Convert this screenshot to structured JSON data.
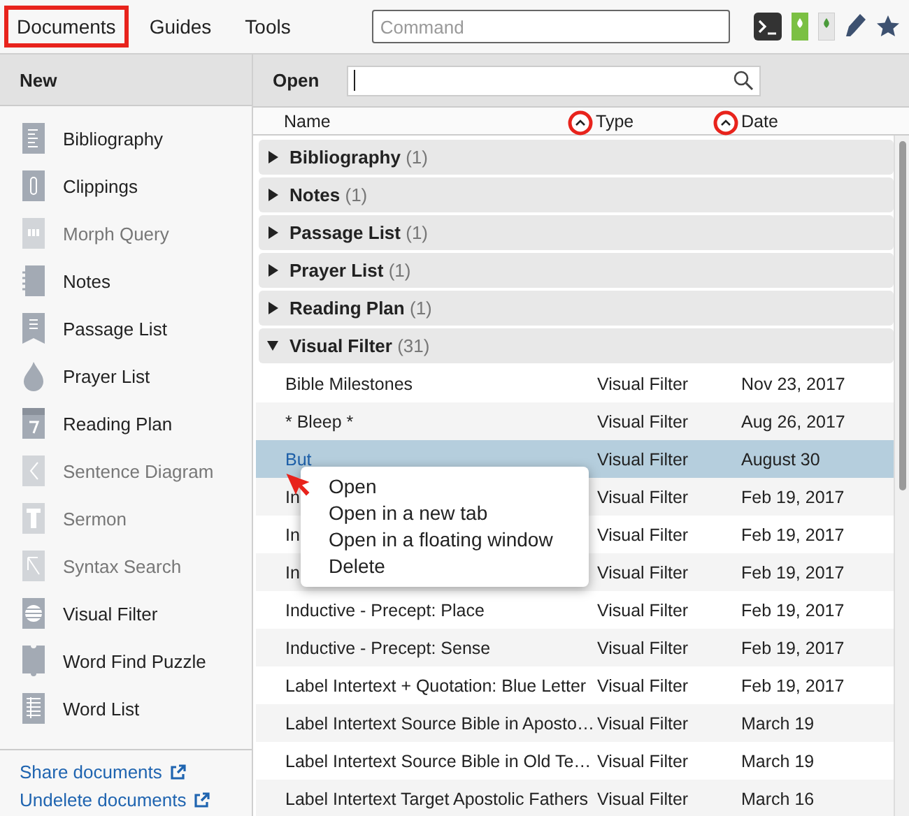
{
  "menu": [
    {
      "label": "Documents",
      "annotated": true
    },
    {
      "label": "Guides",
      "annotated": false
    },
    {
      "label": "Tools",
      "annotated": false
    }
  ],
  "command": {
    "placeholder": "Command"
  },
  "sidebar": {
    "title": "New",
    "items": [
      {
        "label": "Bibliography",
        "disabled": false
      },
      {
        "label": "Clippings",
        "disabled": false
      },
      {
        "label": "Morph Query",
        "disabled": true
      },
      {
        "label": "Notes",
        "disabled": false
      },
      {
        "label": "Passage List",
        "disabled": false
      },
      {
        "label": "Prayer List",
        "disabled": false
      },
      {
        "label": "Reading Plan",
        "disabled": false
      },
      {
        "label": "Sentence Diagram",
        "disabled": true
      },
      {
        "label": "Sermon",
        "disabled": true
      },
      {
        "label": "Syntax Search",
        "disabled": true
      },
      {
        "label": "Visual Filter",
        "disabled": false
      },
      {
        "label": "Word Find Puzzle",
        "disabled": false
      },
      {
        "label": "Word List",
        "disabled": false
      }
    ],
    "links": [
      "Share documents",
      "Undelete documents"
    ]
  },
  "open": {
    "label": "Open"
  },
  "table": {
    "columns": [
      {
        "label": "Name",
        "annotated": false
      },
      {
        "label": "Type",
        "annotated": true
      },
      {
        "label": "Date",
        "annotated": true
      }
    ],
    "groups": [
      {
        "label": "Bibliography",
        "count": "(1)",
        "expanded": false
      },
      {
        "label": "Notes",
        "count": "(1)",
        "expanded": false
      },
      {
        "label": "Passage List",
        "count": "(1)",
        "expanded": false
      },
      {
        "label": "Prayer List",
        "count": "(1)",
        "expanded": false
      },
      {
        "label": "Reading Plan",
        "count": "(1)",
        "expanded": false
      },
      {
        "label": "Visual Filter",
        "count": "(31)",
        "expanded": true,
        "rows": [
          {
            "name": "Bible Milestones",
            "type": "Visual Filter",
            "date": "Nov 23, 2017",
            "selected": false
          },
          {
            "name": "* Bleep *",
            "type": "Visual Filter",
            "date": "Aug 26, 2017",
            "selected": false
          },
          {
            "name": "But",
            "type": "Visual Filter",
            "date": "August 30",
            "selected": true
          },
          {
            "name": "In",
            "type": "Visual Filter",
            "date": "Feb 19, 2017",
            "selected": false
          },
          {
            "name": "In",
            "type": "Visual Filter",
            "date": "Feb 19, 2017",
            "selected": false
          },
          {
            "name": "In",
            "type": "Visual Filter",
            "date": "Feb 19, 2017",
            "selected": false
          },
          {
            "name": "Inductive - Precept: Place",
            "type": "Visual Filter",
            "date": "Feb 19, 2017",
            "selected": false
          },
          {
            "name": "Inductive - Precept: Sense",
            "type": "Visual Filter",
            "date": "Feb 19, 2017",
            "selected": false
          },
          {
            "name": "Label Intertext + Quotation: Blue Letter",
            "type": "Visual Filter",
            "date": "Feb 19, 2017",
            "selected": false
          },
          {
            "name": "Label Intertext Source Bible in Aposto…",
            "type": "Visual Filter",
            "date": "March 19",
            "selected": false
          },
          {
            "name": "Label Intertext Source Bible in Old Te…",
            "type": "Visual Filter",
            "date": "March 19",
            "selected": false
          },
          {
            "name": "Label Intertext Target Apostolic Fathers",
            "type": "Visual Filter",
            "date": "March 16",
            "selected": false
          }
        ]
      }
    ]
  },
  "context_menu": {
    "items": [
      "Open",
      "Open in a new tab",
      "Open in a floating window",
      "Delete"
    ]
  }
}
